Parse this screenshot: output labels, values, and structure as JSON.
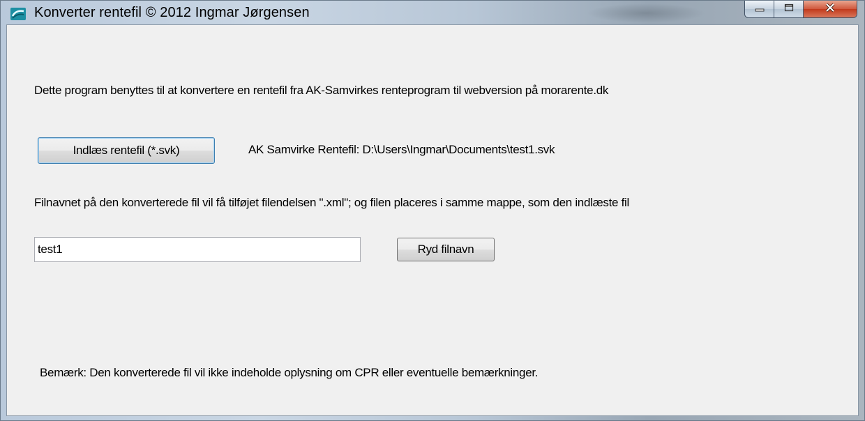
{
  "window": {
    "title": "Konverter rentefil © 2012 Ingmar Jørgensen",
    "controls": {
      "minimize": "minimize-icon",
      "maximize": "maximize-icon",
      "close": "close-icon"
    }
  },
  "content": {
    "intro": "Dette program benyttes til at konvertere en rentefil  fra AK-Samvirkes renteprogram til webversion på morarente.dk",
    "load_button": "Indlæs rentefil (*.svk)",
    "file_path_label": "AK Samvirke Rentefil: D:\\Users\\Ingmar\\Documents\\test1.svk",
    "filename_info": "Filnavnet på den konverterede  fil vil få tilføjet filendelsen \".xml\"; og filen placeres i samme mappe, som den indlæste fil",
    "filename_value": "test1",
    "clear_button": "Ryd filnavn",
    "note": "Bemærk: Den konverterede fil vil ikke indeholde oplysning om CPR eller eventuelle bemærkninger."
  },
  "colors": {
    "client_bg": "#f0f0f0",
    "close_button": "#c7452a",
    "focus_border": "#3c7fb1"
  }
}
